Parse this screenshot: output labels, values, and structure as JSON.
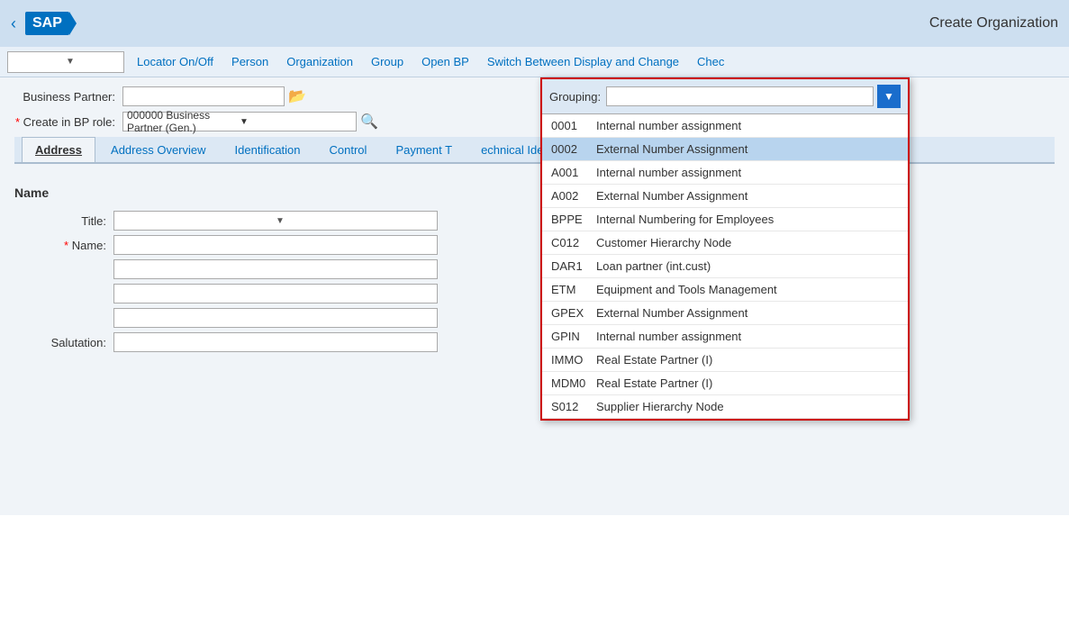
{
  "header": {
    "title": "Create Organization",
    "back_label": "‹"
  },
  "toolbar": {
    "dropdown_placeholder": "",
    "buttons": [
      {
        "id": "locator",
        "label": "Locator On/Off"
      },
      {
        "id": "person",
        "label": "Person"
      },
      {
        "id": "organization",
        "label": "Organization"
      },
      {
        "id": "group",
        "label": "Group"
      },
      {
        "id": "open_bp",
        "label": "Open BP"
      },
      {
        "id": "switch",
        "label": "Switch Between Display and Change"
      },
      {
        "id": "check",
        "label": "Chec"
      }
    ]
  },
  "form": {
    "business_partner_label": "Business Partner:",
    "create_in_bp_role_label": "Create in BP role:",
    "bp_role_value": "000000 Business Partner (Gen.)"
  },
  "grouping": {
    "label": "Grouping:",
    "input_value": "",
    "items": [
      {
        "code": "0001",
        "desc": "Internal number assignment",
        "selected": false
      },
      {
        "code": "0002",
        "desc": "External Number Assignment",
        "selected": true
      },
      {
        "code": "A001",
        "desc": "Internal number assignment",
        "selected": false
      },
      {
        "code": "A002",
        "desc": "External Number Assignment",
        "selected": false
      },
      {
        "code": "BPPE",
        "desc": "Internal Numbering for Employees",
        "selected": false
      },
      {
        "code": "C012",
        "desc": "Customer Hierarchy Node",
        "selected": false
      },
      {
        "code": "DAR1",
        "desc": "Loan partner (int.cust)",
        "selected": false
      },
      {
        "code": "ETM",
        "desc": "Equipment and Tools Management",
        "selected": false
      },
      {
        "code": "GPEX",
        "desc": "External Number Assignment",
        "selected": false
      },
      {
        "code": "GPIN",
        "desc": "Internal number assignment",
        "selected": false
      },
      {
        "code": "IMMO",
        "desc": "Real Estate Partner (I)",
        "selected": false
      },
      {
        "code": "MDM0",
        "desc": "Real Estate Partner (I)",
        "selected": false
      },
      {
        "code": "S012",
        "desc": "Supplier Hierarchy Node",
        "selected": false
      }
    ]
  },
  "tabs": [
    {
      "id": "address",
      "label": "Address",
      "active": true
    },
    {
      "id": "address_overview",
      "label": "Address Overview",
      "active": false
    },
    {
      "id": "identification",
      "label": "Identification",
      "active": false
    },
    {
      "id": "control",
      "label": "Control",
      "active": false
    },
    {
      "id": "payment_t",
      "label": "Payment T",
      "active": false
    },
    {
      "id": "technical_ident",
      "label": "echnical Identificat",
      "active": false
    }
  ],
  "name_section": {
    "title": "Name",
    "title_label": "Title:",
    "name_label": "Name:",
    "salutation_label": "Salutation:"
  },
  "colors": {
    "header_bg": "#cddff0",
    "toolbar_bg": "#e8f0f8",
    "content_bg": "#f0f4f8",
    "tab_active_bg": "#f0f4f8",
    "tab_inactive_bg": "#dce8f4",
    "link_color": "#0070c0",
    "selected_row_bg": "#b8d4ee",
    "popup_border": "#cc0000",
    "expand_btn_bg": "#1a6dcc"
  }
}
